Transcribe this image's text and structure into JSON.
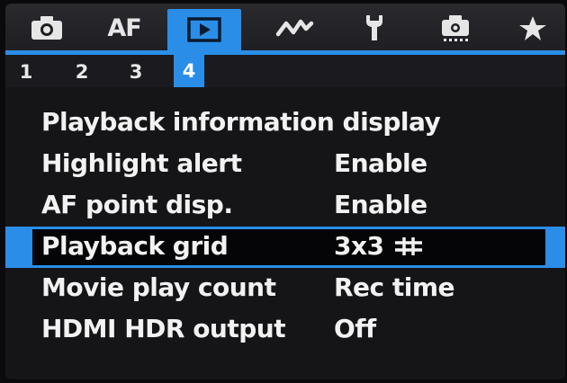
{
  "tabs": [
    {
      "id": "shooting",
      "icon": "camera-icon"
    },
    {
      "id": "af",
      "label": "AF"
    },
    {
      "id": "playback",
      "icon": "playback-icon",
      "active": true
    },
    {
      "id": "wireless",
      "icon": "wireless-icon"
    },
    {
      "id": "setup",
      "icon": "wrench-icon"
    },
    {
      "id": "custom",
      "icon": "custom-functions-icon"
    },
    {
      "id": "mymenu",
      "icon": "star-icon"
    }
  ],
  "subtabs": [
    "1",
    "2",
    "3",
    "4"
  ],
  "active_subtab": "4",
  "menu": {
    "items": [
      {
        "label": "Playback information display",
        "value": ""
      },
      {
        "label": "Highlight alert",
        "value": "Enable"
      },
      {
        "label": "AF point disp.",
        "value": "Enable"
      },
      {
        "label": "Playback grid",
        "value": "3x3",
        "value_icon": "grid-3x3-icon",
        "selected": true
      },
      {
        "label": "Movie play count",
        "value": "Rec time"
      },
      {
        "label": "HDMI HDR output",
        "value": "Off"
      }
    ]
  },
  "colors": {
    "accent": "#2a8ee8",
    "background": "#151518",
    "text": "#f2f2f2"
  }
}
